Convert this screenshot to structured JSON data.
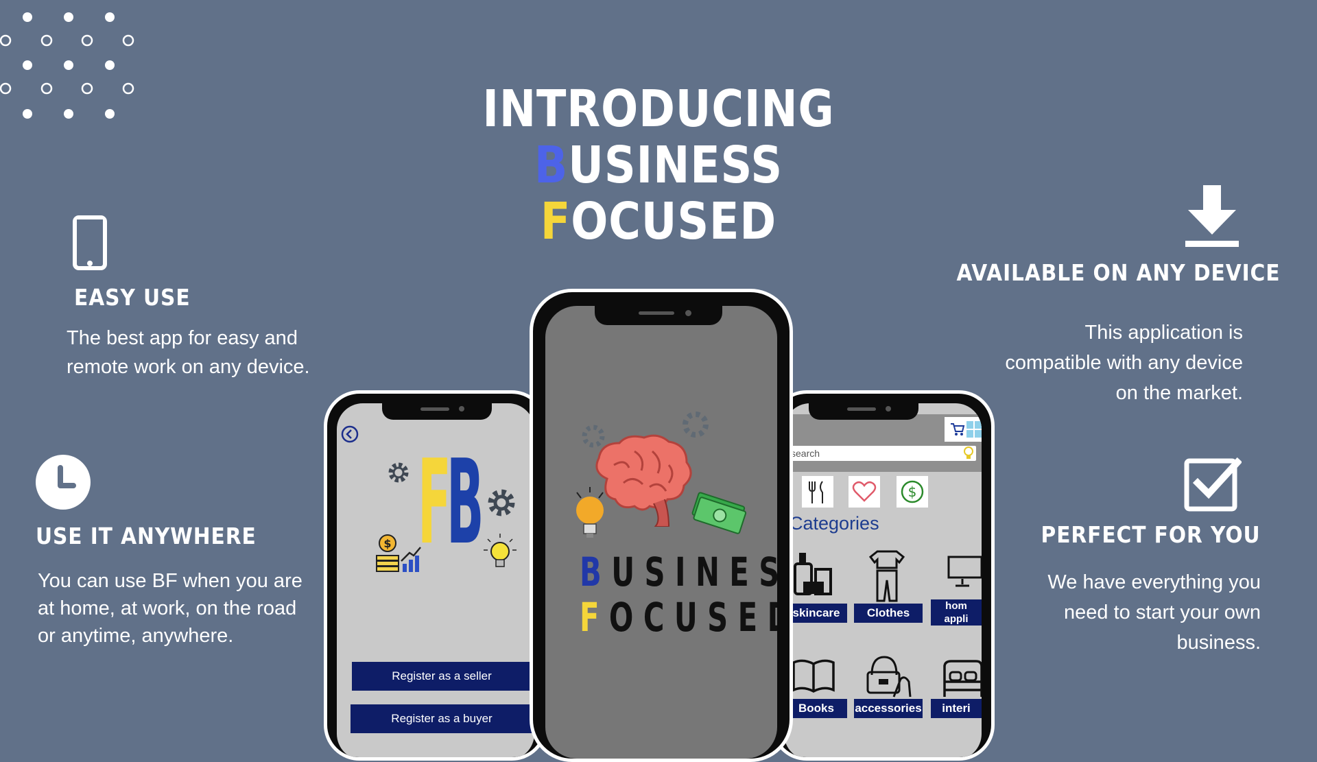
{
  "title": {
    "line1": "INTRODUCING",
    "line2_b": "B",
    "line2_rest1": "USINESS ",
    "line2_f": "F",
    "line2_rest2": "OCUSED"
  },
  "features": {
    "easy_use": {
      "icon": "phone-icon",
      "heading": "EASY USE",
      "line1": "The best app for easy and",
      "line2": "remote work on any device."
    },
    "anywhere": {
      "icon": "clock-icon",
      "heading": "USE IT ANYWHERE",
      "line1": "You can use BF when you are",
      "line2": "at home, at work, on the road",
      "line3": "or anytime, anywhere."
    },
    "available": {
      "icon": "download-icon",
      "heading": "AVAILABLE ON ANY DEVICE",
      "line1": "This application is",
      "line2": "compatible with any device",
      "line3": "on the market."
    },
    "perfect": {
      "icon": "checkbox-icon",
      "heading": "PERFECT FOR YOU",
      "line1": "We have everything you",
      "line2": "need to start your own",
      "line3": "business."
    }
  },
  "left_phone": {
    "logo_f": "F",
    "logo_b": "B",
    "seller_button": "Register as a seller",
    "buyer_button": "Register as a buyer"
  },
  "center_phone": {
    "logo_b": "B",
    "logo_usiness": "USINESS",
    "logo_f": "F",
    "logo_ocused": "OCUSED"
  },
  "right_phone": {
    "search_placeholder": "search",
    "categories_title": "Categories",
    "categories": [
      "skincare",
      "Clothes",
      "hom\nappli",
      "Books",
      "accessories",
      "interi"
    ]
  },
  "colors": {
    "background": "#617189",
    "accent_blue": "#4d63e8",
    "accent_yellow": "#f5d63a",
    "button_navy": "#0e1d67"
  }
}
